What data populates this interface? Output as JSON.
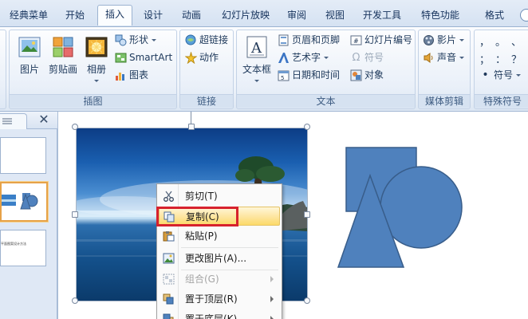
{
  "tabs": [
    {
      "label": "经典菜单",
      "active": false
    },
    {
      "label": "开始",
      "active": false
    },
    {
      "label": "插入",
      "active": true
    },
    {
      "label": "设计",
      "active": false
    },
    {
      "label": "动画",
      "active": false
    },
    {
      "label": "幻灯片放映",
      "active": false
    },
    {
      "label": "审阅",
      "active": false
    },
    {
      "label": "视图",
      "active": false
    },
    {
      "label": "开发工具",
      "active": false
    },
    {
      "label": "特色功能",
      "active": false
    },
    {
      "label": "格式",
      "active": false
    }
  ],
  "groups": {
    "illustrations": {
      "label": "插图",
      "picture": "图片",
      "clipart": "剪贴画",
      "album": "相册",
      "shapes": "形状",
      "smartart": "SmartArt",
      "chart": "图表"
    },
    "links": {
      "label": "链接",
      "hyperlink": "超链接",
      "action": "动作"
    },
    "text": {
      "label": "文本",
      "textbox": "文本框",
      "header_footer": "页眉和页脚",
      "wordart": "艺术字",
      "datetime": "日期和时间",
      "slide_number": "幻灯片编号",
      "symbol": "符号",
      "object": "对象"
    },
    "media": {
      "label": "媒体剪辑",
      "movie": "影片",
      "sound": "声音"
    },
    "special": {
      "label": "特殊符号",
      "symbol": "符号",
      "marks_row1": [
        "，",
        "。",
        "、"
      ],
      "marks_row2": [
        "；",
        "：",
        "？"
      ]
    }
  },
  "context_menu": {
    "items": [
      {
        "label": "剪切(T)",
        "icon": "scissors-icon",
        "disabled": false,
        "highlighted": false,
        "submenu": false
      },
      {
        "label": "复制(C)",
        "icon": "copy-icon",
        "disabled": false,
        "highlighted": true,
        "submenu": false
      },
      {
        "label": "粘贴(P)",
        "icon": "paste-icon",
        "disabled": false,
        "highlighted": false,
        "submenu": false
      },
      {
        "label": "更改图片(A)...",
        "icon": "change-picture-icon",
        "disabled": false,
        "highlighted": false,
        "submenu": false
      },
      {
        "label": "组合(G)",
        "icon": "group-icon",
        "disabled": true,
        "highlighted": false,
        "submenu": true
      },
      {
        "label": "置于顶层(R)",
        "icon": "bring-to-front-icon",
        "disabled": false,
        "highlighted": false,
        "submenu": true
      },
      {
        "label": "置于底层(K)",
        "icon": "send-to-back-icon",
        "disabled": false,
        "highlighted": false,
        "submenu": true
      }
    ]
  },
  "thumbnails": {
    "slide3_caption": "平面图案设计方法"
  },
  "colors": {
    "shape_fill": "#4f81bd",
    "shape_stroke": "#385d8a",
    "highlight_box": "#d7212d",
    "menu_highlight": "#fde59e"
  }
}
